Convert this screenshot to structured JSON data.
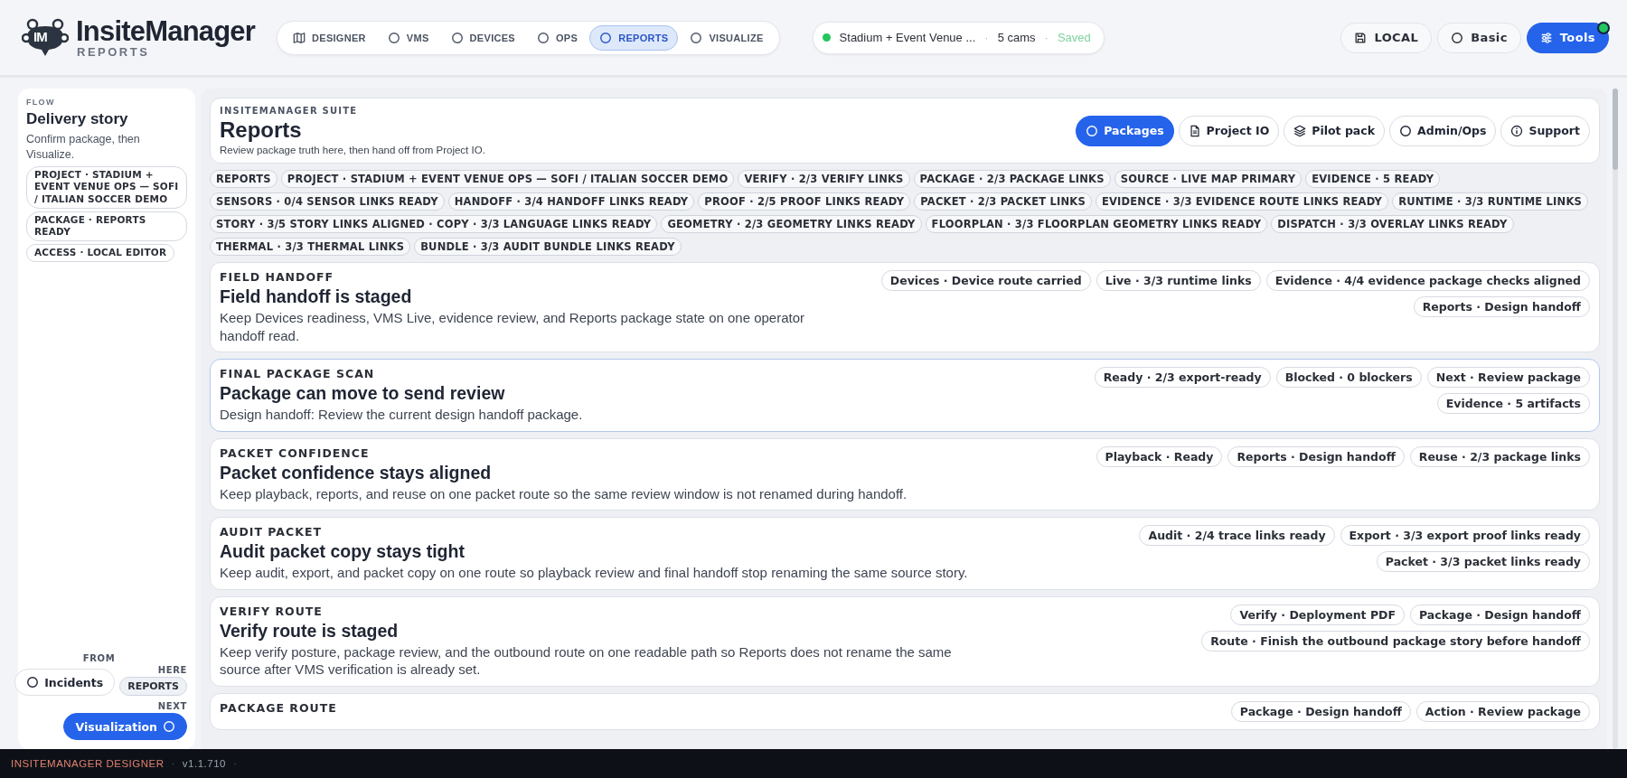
{
  "brand": {
    "mark": "IM",
    "name": "InsiteManager",
    "subtitle": "REPORTS"
  },
  "nav": [
    {
      "label": "DESIGNER",
      "kind": "map",
      "selected": false
    },
    {
      "label": "VMS",
      "kind": "radio",
      "selected": false
    },
    {
      "label": "DEVICES",
      "kind": "radio",
      "selected": false
    },
    {
      "label": "OPS",
      "kind": "radio",
      "selected": false
    },
    {
      "label": "REPORTS",
      "kind": "radio",
      "selected": true
    },
    {
      "label": "VISUALIZE",
      "kind": "radio",
      "selected": false
    }
  ],
  "project": {
    "online": true,
    "parts": [
      {
        "kind": "name",
        "text": "Stadium + Event Venue ..."
      },
      {
        "kind": "sep",
        "text": "·"
      },
      {
        "kind": "count",
        "text": "5 cams"
      },
      {
        "kind": "sep",
        "text": "·"
      },
      {
        "kind": "status",
        "text": "Saved"
      }
    ]
  },
  "actions": [
    {
      "label": "LOCAL",
      "kind": "save",
      "selected": false
    },
    {
      "label": "Basic",
      "kind": "radio",
      "selected": false
    },
    {
      "label": "Tools",
      "kind": "sliders",
      "selected": true,
      "badge": true
    }
  ],
  "sidebar": {
    "eyebrow": "FLOW",
    "title": "Delivery story",
    "description": "Confirm package, then Visualize.",
    "tags": [
      "PROJECT · STADIUM + EVENT VENUE OPS — SOFI / ITALIAN SOCCER DEMO",
      "PACKAGE · REPORTS READY",
      "ACCESS · LOCAL EDITOR"
    ],
    "from_label": "FROM",
    "from_button": "Incidents",
    "here_label": "HERE",
    "here_chip": "REPORTS",
    "next_label": "NEXT",
    "next_button": "Visualization"
  },
  "header": {
    "eyebrow": "INSITEMANAGER SUITE",
    "title": "Reports",
    "subtitle": "Review package truth here, then hand off from Project IO.",
    "tabs": [
      {
        "label": "Packages",
        "kind": "radio",
        "selected": true
      },
      {
        "label": "Project IO",
        "kind": "doc",
        "selected": false
      },
      {
        "label": "Pilot pack",
        "kind": "layers",
        "selected": false
      },
      {
        "label": "Admin/Ops",
        "kind": "radio",
        "selected": false
      },
      {
        "label": "Support",
        "kind": "info",
        "selected": false
      }
    ]
  },
  "tags": [
    "REPORTS",
    "PROJECT · STADIUM + EVENT VENUE OPS — SOFI / ITALIAN SOCCER DEMO",
    "VERIFY · 2/3 VERIFY LINKS",
    "PACKAGE · 2/3 PACKAGE LINKS",
    "SOURCE · LIVE MAP PRIMARY",
    "EVIDENCE · 5 READY",
    "SENSORS · 0/4 SENSOR LINKS READY",
    "HANDOFF · 3/4 HANDOFF LINKS READY",
    "PROOF · 2/5 PROOF LINKS READY",
    "PACKET · 2/3 PACKET LINKS",
    "EVIDENCE · 3/3 EVIDENCE ROUTE LINKS READY",
    "RUNTIME · 3/3 RUNTIME LINKS",
    "STORY · 3/5 STORY LINKS ALIGNED · COPY · 3/3 LANGUAGE LINKS READY",
    "GEOMETRY · 2/3 GEOMETRY LINKS READY",
    "FLOORPLAN · 3/3 FLOORPLAN GEOMETRY LINKS READY",
    "DISPATCH · 3/3 OVERLAY LINKS READY",
    "THERMAL · 3/3 THERMAL LINKS",
    "BUNDLE · 3/3 AUDIT BUNDLE LINKS READY"
  ],
  "cards": [
    {
      "eyebrow": "FIELD HANDOFF",
      "title": "Field handoff is staged",
      "description": "Keep Devices readiness, VMS Live, evidence review, and Reports package state on one operator handoff read.",
      "selected": false,
      "chips": [
        "Devices · Device route carried",
        "Live · 3/3 runtime links",
        "Evidence · 4/4 evidence package checks aligned",
        "Reports · Design handoff"
      ]
    },
    {
      "eyebrow": "FINAL PACKAGE SCAN",
      "title": "Package can move to send review",
      "description": "Design handoff: Review the current design handoff package.",
      "selected": true,
      "chips": [
        "Ready · 2/3 export-ready",
        "Blocked · 0 blockers",
        "Next · Review package",
        "Evidence · 5 artifacts"
      ]
    },
    {
      "eyebrow": "PACKET CONFIDENCE",
      "title": "Packet confidence stays aligned",
      "description": "Keep playback, reports, and reuse on one packet route so the same review window is not renamed during handoff.",
      "selected": false,
      "chips": [
        "Playback · Ready",
        "Reports · Design handoff",
        "Reuse · 2/3 package links"
      ]
    },
    {
      "eyebrow": "AUDIT PACKET",
      "title": "Audit packet copy stays tight",
      "description": "Keep audit, export, and packet copy on one route so playback review and final handoff stop renaming the same source story.",
      "selected": false,
      "chips": [
        "Audit · 2/4 trace links ready",
        "Export · 3/3 export proof links ready",
        "Packet · 3/3 packet links ready"
      ]
    },
    {
      "eyebrow": "VERIFY ROUTE",
      "title": "Verify route is staged",
      "description": "Keep verify posture, package review, and the outbound route on one readable path so Reports does not rename the same source after VMS verification is already set.",
      "selected": false,
      "chips": [
        "Verify · Deployment PDF",
        "Package · Design handoff",
        "Route · Finish the outbound package story before handoff"
      ]
    },
    {
      "eyebrow": "PACKAGE ROUTE",
      "selected": false,
      "chips": [
        "Package · Design handoff",
        "Action · Review package"
      ]
    }
  ],
  "footer": [
    {
      "kind": "product",
      "text": "INSITEMANAGER DESIGNER"
    },
    {
      "kind": "sep",
      "text": "·"
    },
    {
      "kind": "version",
      "text": "v1.1.710"
    },
    {
      "kind": "sep",
      "text": "·"
    }
  ]
}
